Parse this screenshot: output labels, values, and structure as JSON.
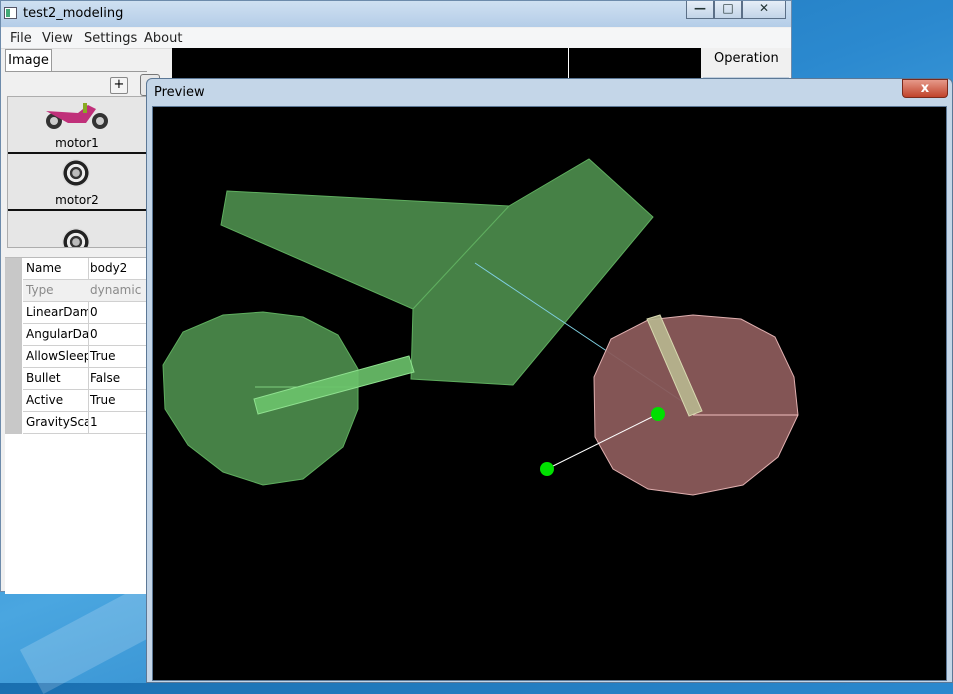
{
  "main_window": {
    "title": "test2_modeling",
    "caption_buttons": [
      "—",
      "□",
      "✕"
    ],
    "menu": [
      "File",
      "View",
      "Settings",
      "About"
    ],
    "tab_label": "Image",
    "add_button_label": "+",
    "operation_label": "Operation"
  },
  "image_list": [
    {
      "label": "motor1",
      "icon": "motorbike-thumbnail-icon"
    },
    {
      "label": "motor2",
      "icon": "wheel-thumbnail-icon"
    },
    {
      "label": "",
      "icon": "wheel-thumbnail-icon"
    }
  ],
  "properties": [
    {
      "name": "Name",
      "value": "body2",
      "disabled": false
    },
    {
      "name": "Type",
      "value": "dynamic",
      "disabled": true
    },
    {
      "name": "LinearDamping",
      "value": "0",
      "disabled": false
    },
    {
      "name": "AngularDamping",
      "value": "0",
      "disabled": false
    },
    {
      "name": "AllowSleep",
      "value": "True",
      "disabled": false
    },
    {
      "name": "Bullet",
      "value": "False",
      "disabled": false
    },
    {
      "name": "Active",
      "value": "True",
      "disabled": false
    },
    {
      "name": "GravityScale",
      "value": "1",
      "disabled": false
    }
  ],
  "preview_window": {
    "title": "Preview",
    "close_label": "x"
  },
  "colors": {
    "body_fill": "#4e8f4e",
    "selected_wheel_fill": "#8a5a5a",
    "joint_point": "#00e000",
    "canvas_bg": "#000000"
  }
}
